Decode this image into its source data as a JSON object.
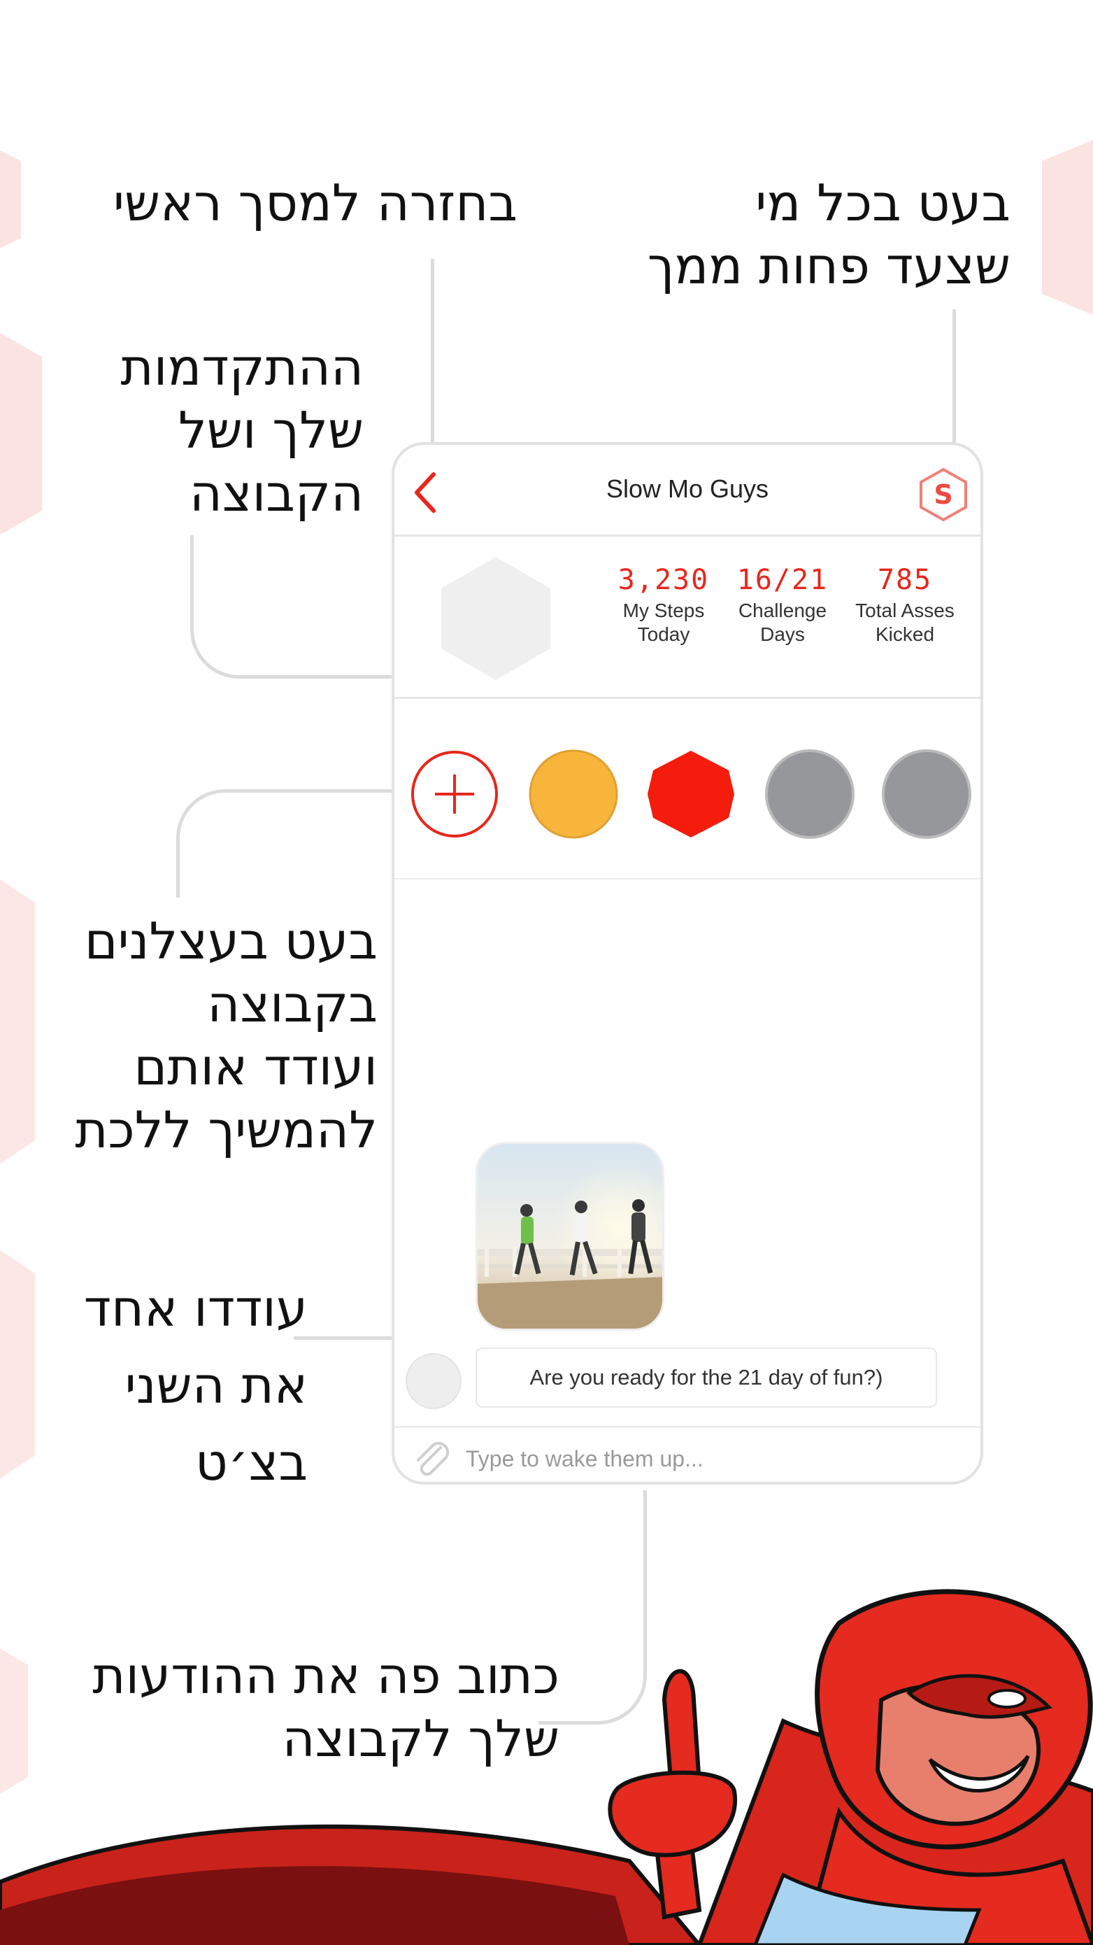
{
  "colors": {
    "accent": "#e8261b",
    "member_orange": "#f7b53c",
    "member_red": "#f31c0d",
    "member_gray": "#95979a",
    "avatar_placeholder": "#efefef"
  },
  "callouts": {
    "tap_slower": [
      "בעט בכל מי",
      "שצעד פחות ממך"
    ],
    "back_home": "בחזרה למסך ראשי",
    "progress": [
      "ההתקדמות",
      "שלך ושל",
      "הקבוצה"
    ],
    "kick_members": [
      "בעט בעצלנים",
      "בקבוצה",
      "ועודד אותם",
      "להמשיך ללכת"
    ],
    "encourage_chat": [
      "עודדו אחד",
      "את השני",
      "בצ׳ט"
    ],
    "write_messages": [
      "כתוב פה את ההודעות",
      "שלך לקבוצה"
    ]
  },
  "app": {
    "title": "Slow Mo Guys",
    "back_icon": "chevron-left-icon",
    "logo_icon": "hex-s-logo-icon",
    "logo_letter": "S",
    "stats": [
      {
        "value": "3,230",
        "label_line1": "My Steps",
        "label_line2": "Today"
      },
      {
        "value": "16/21",
        "label_line1": "Challenge",
        "label_line2": "Days"
      },
      {
        "value": "785",
        "label_line1": "Total Asses",
        "label_line2": "Kicked"
      }
    ],
    "members": [
      {
        "name": "add-member",
        "icon": "plus-icon"
      },
      {
        "name": "member-orange",
        "color": "orange"
      },
      {
        "name": "member-red",
        "color": "red"
      },
      {
        "name": "member-gray-1",
        "color": "gray"
      },
      {
        "name": "member-gray-2",
        "color": "gray"
      }
    ],
    "chat": {
      "photo_icon": "runners-photo",
      "message": "Are you ready for the 21 day of fun?)"
    },
    "composer": {
      "attach_icon": "paperclip-icon",
      "placeholder": "Type to wake them up..."
    }
  }
}
